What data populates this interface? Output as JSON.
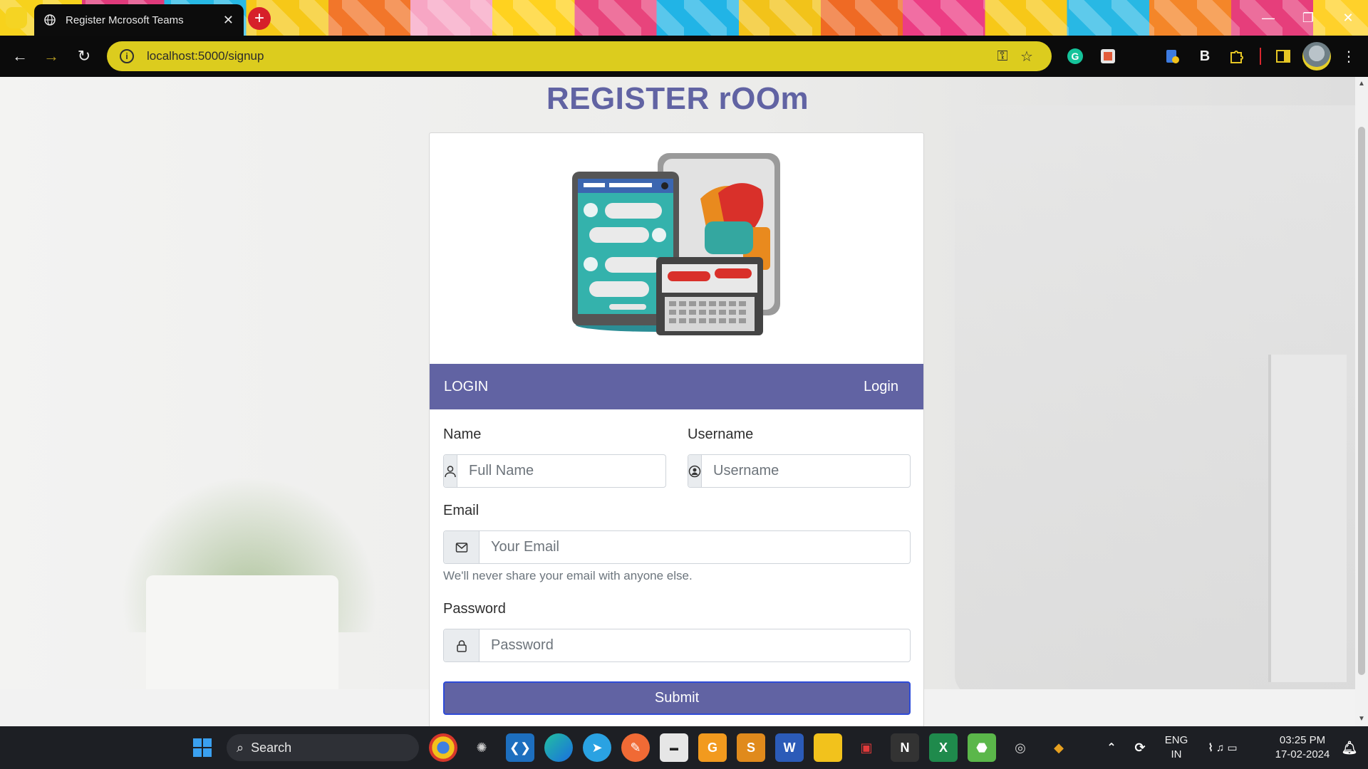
{
  "browser": {
    "tab_title": "Register Mcrosoft Teams",
    "url": "localhost:5000/signup"
  },
  "page": {
    "title": "REGISTER rOOm",
    "header_left": "LOGIN",
    "header_link": "Login",
    "fields": {
      "name": {
        "label": "Name",
        "placeholder": "Full Name",
        "value": ""
      },
      "username": {
        "label": "Username",
        "placeholder": "Username",
        "value": ""
      },
      "email": {
        "label": "Email",
        "placeholder": "Your Email",
        "value": "",
        "help": "We'll never share your email with anyone else."
      },
      "password": {
        "label": "Password",
        "placeholder": "Password",
        "value": ""
      }
    },
    "submit_label": "Submit"
  },
  "colors": {
    "brand": "#6163a3",
    "address_bar": "#dccc1e",
    "taskbar": "#1d1f24"
  },
  "taskbar": {
    "search_label": "Search",
    "lang_line1": "ENG",
    "lang_line2": "IN",
    "time": "03:25 PM",
    "date": "17-02-2024"
  }
}
